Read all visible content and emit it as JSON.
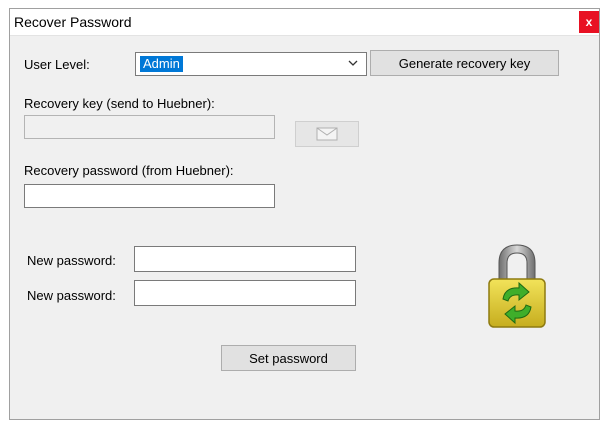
{
  "window": {
    "title": "Recover Password",
    "close_label": "x"
  },
  "form": {
    "user_level_label": "User Level:",
    "user_level_value": "Admin",
    "generate_button": "Generate recovery key",
    "recovery_key_label": "Recovery key (send to Huebner):",
    "recovery_key_value": "",
    "recovery_password_label": "Recovery password (from Huebner):",
    "recovery_password_value": "",
    "new_password_label_1": "New password:",
    "new_password_label_2": "New password:",
    "set_password_button": "Set password"
  },
  "icons": {
    "mail": "mail-icon",
    "lock": "lock-icon",
    "dropdown": "chevron-down-icon"
  },
  "colors": {
    "selection": "#0078d7",
    "close": "#e81123",
    "lock_body": "#d8c438",
    "lock_arrows": "#3fae2a"
  }
}
